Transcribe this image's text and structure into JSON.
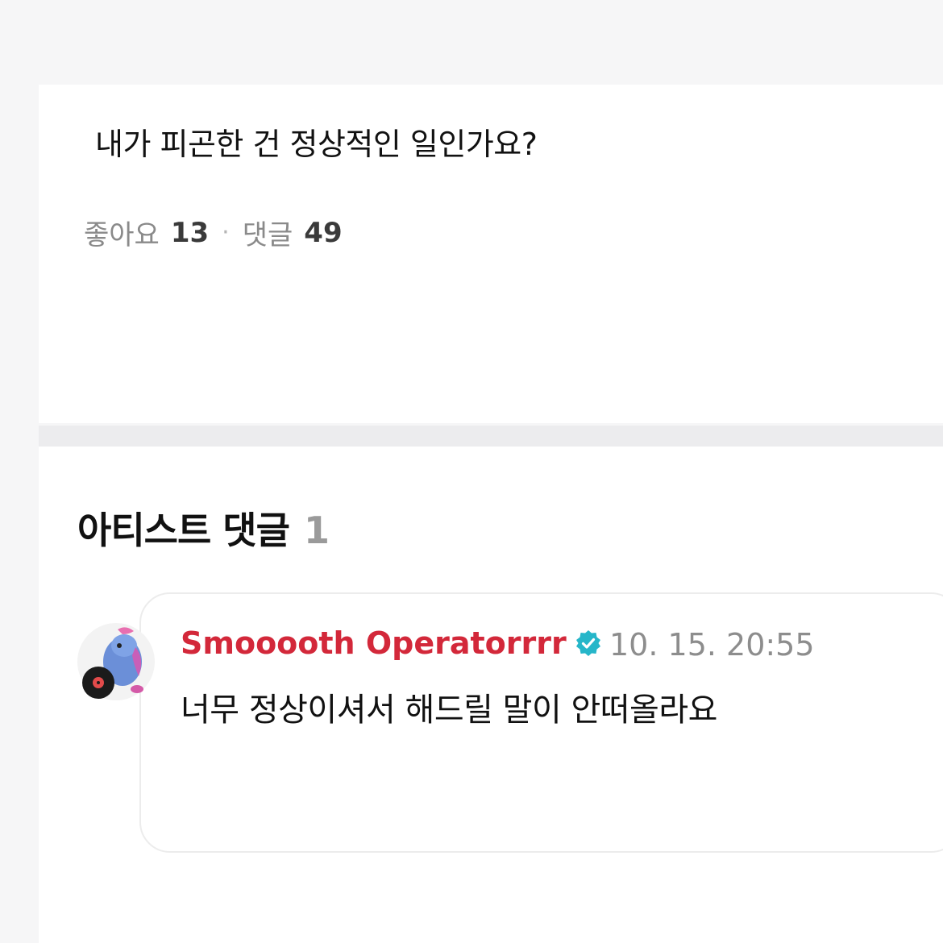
{
  "post": {
    "text": "내가 피곤한 건 정상적인 일인가요?",
    "likes_label": "좋아요",
    "likes_count": "13",
    "separator": "·",
    "comments_label": "댓글",
    "comments_count": "49"
  },
  "artist_comments": {
    "title": "아티스트 댓글",
    "count": "1",
    "items": [
      {
        "author": "Smooooth Operatorrrr",
        "verified_icon": "verified-badge-icon",
        "time": "10. 15. 20:55",
        "text": "너무 정상이셔서 해드릴 말이 안떠올라요",
        "author_color": "#d3283a",
        "verified_color": "#26b6c9"
      }
    ]
  }
}
